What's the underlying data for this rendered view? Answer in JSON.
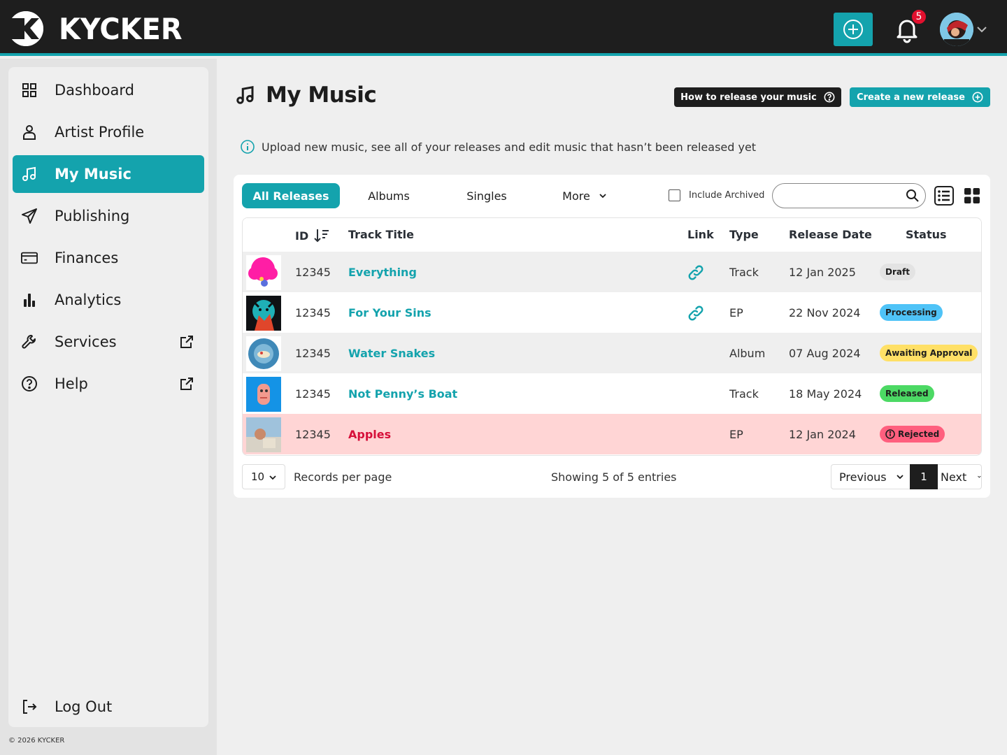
{
  "app": {
    "brand": "KYCKER",
    "notification_count": "5",
    "accent": "#14a3ad"
  },
  "sidebar": {
    "items": [
      {
        "label": "Dashboard",
        "icon": "dashboard-grid-icon"
      },
      {
        "label": "Artist Profile",
        "icon": "user-icon"
      },
      {
        "label": "My Music",
        "icon": "music-note-icon",
        "active": true
      },
      {
        "label": "Publishing",
        "icon": "paper-plane-icon"
      },
      {
        "label": "Finances",
        "icon": "credit-card-icon"
      },
      {
        "label": "Analytics",
        "icon": "bar-chart-icon"
      },
      {
        "label": "Services",
        "icon": "wrench-icon",
        "external": true
      },
      {
        "label": "Help",
        "icon": "help-circle-icon",
        "external": true
      }
    ],
    "logout": "Log Out",
    "copyright": "© 2026 KYCKER"
  },
  "main": {
    "title": "My Music",
    "how_button": "How to release your music",
    "create_button": "Create a new release",
    "info": "Upload new music, see all of your releases and edit music that hasn’t been released yet",
    "tabs": [
      "All Releases",
      "Albums",
      "Singles",
      "More"
    ],
    "include_archived": "Include Archived",
    "search_placeholder": ""
  },
  "table": {
    "headers": {
      "id": "ID",
      "title": "Track Title",
      "link": "Link",
      "type": "Type",
      "date": "Release Date",
      "status": "Status"
    },
    "rows": [
      {
        "id": "12345",
        "title": "Everything",
        "has_link": true,
        "type": "Track",
        "date": "12 Jan 2025",
        "status": "Draft",
        "status_color": "#e3e3e3"
      },
      {
        "id": "12345",
        "title": "For Your Sins",
        "has_link": true,
        "type": "EP",
        "date": "22 Nov 2024",
        "status": "Processing",
        "status_color": "#4fc3f7"
      },
      {
        "id": "12345",
        "title": "Water Snakes",
        "has_link": false,
        "type": "Album",
        "date": "07 Aug 2024",
        "status": "Awaiting Approval",
        "status_color": "#ffe066"
      },
      {
        "id": "12345",
        "title": "Not Penny’s Boat",
        "has_link": false,
        "type": "Track",
        "date": "18 May 2024",
        "status": "Released",
        "status_color": "#4cd964"
      },
      {
        "id": "12345",
        "title": "Apples",
        "has_link": false,
        "type": "EP",
        "date": "12 Jan 2024",
        "status": "Rejected",
        "status_color": "#ff5f7e"
      }
    ]
  },
  "footer": {
    "per_page": "10",
    "per_page_label": "Records per page",
    "showing": "Showing 5 of 5 entries",
    "previous": "Previous",
    "page": "1",
    "next": "Next"
  }
}
